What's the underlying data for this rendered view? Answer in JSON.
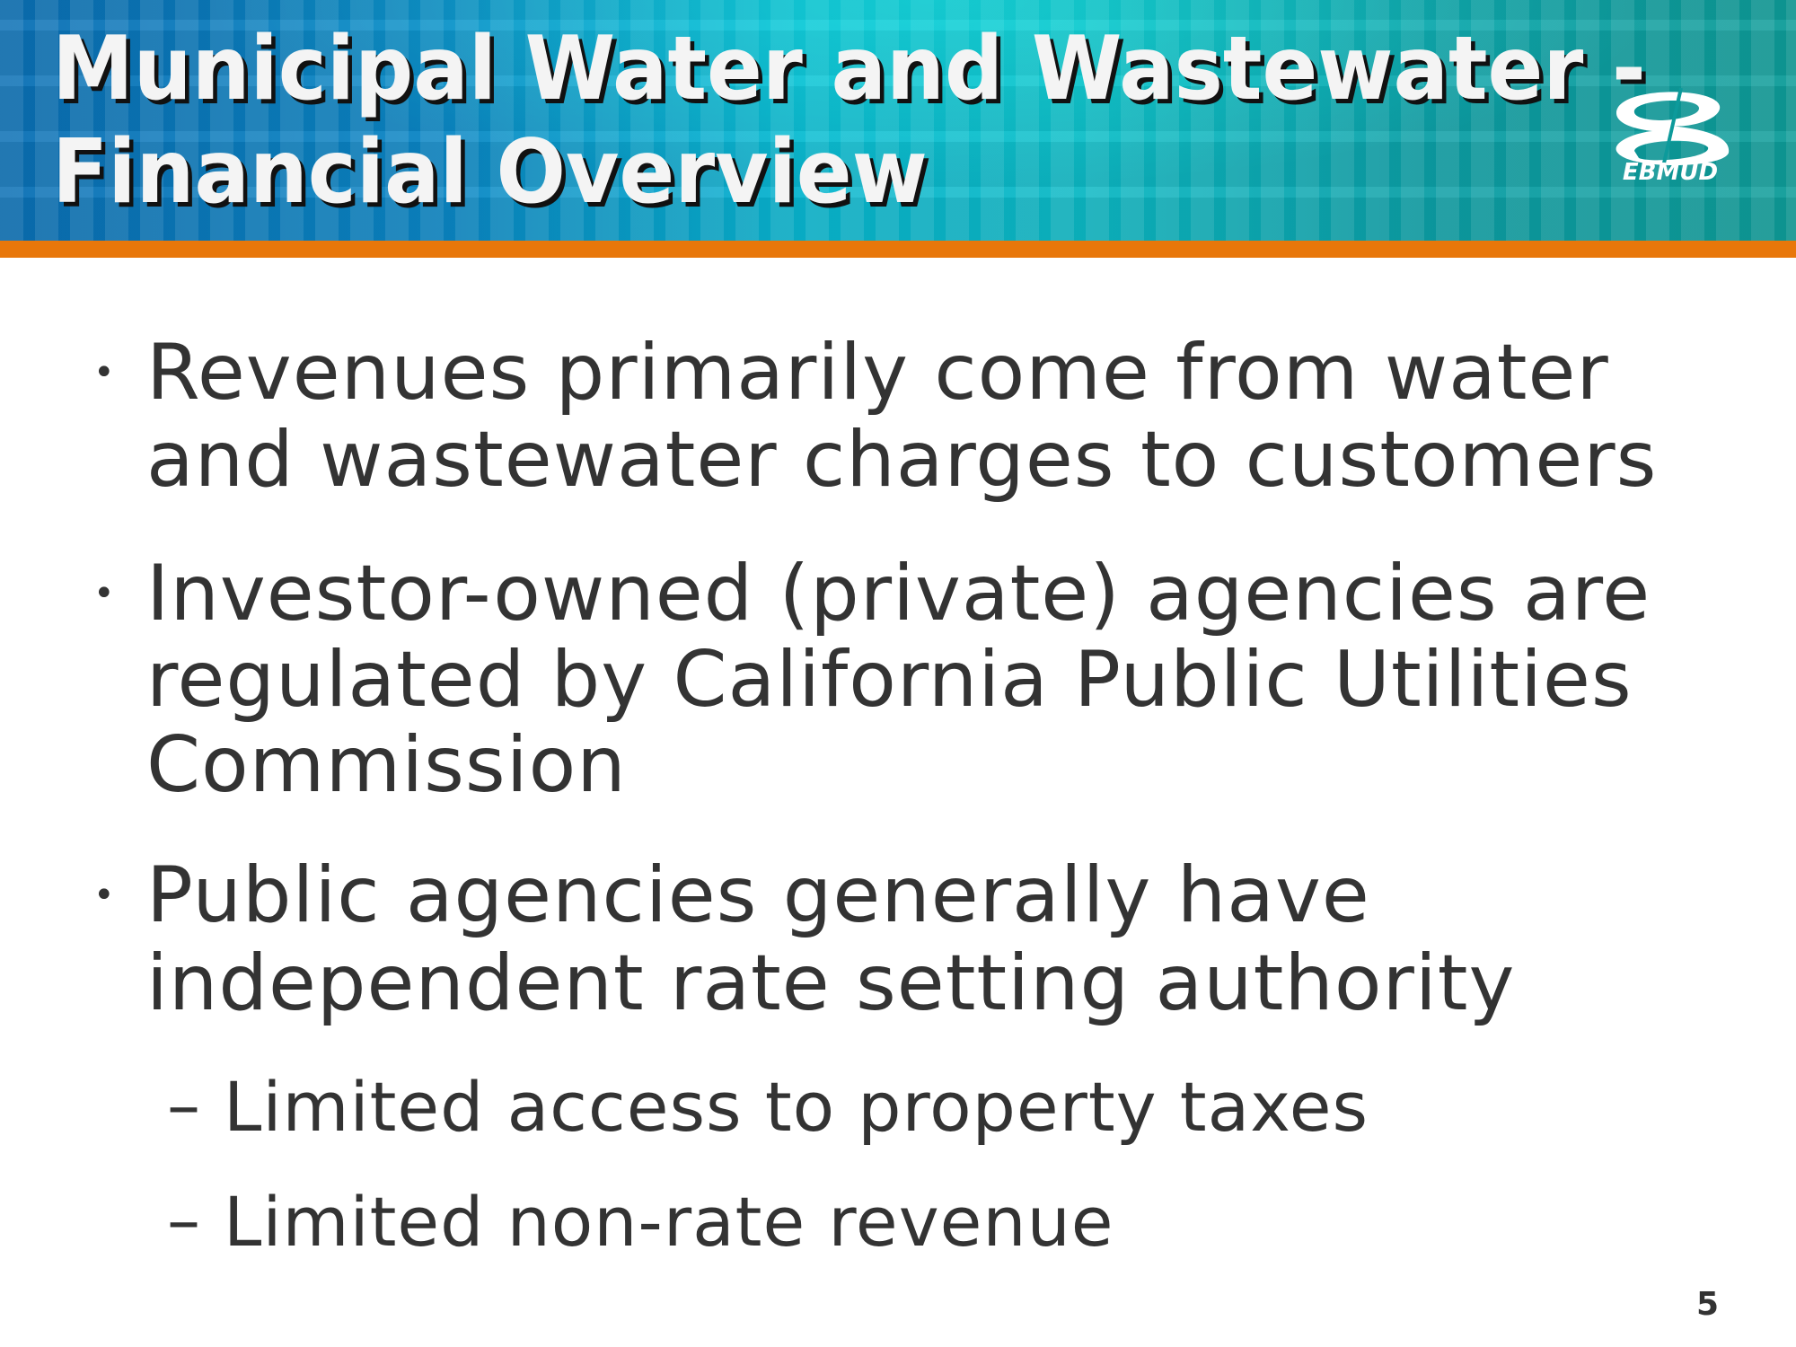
{
  "header": {
    "title_lines": [
      "Municipal Water and Wastewater -",
      "Financial Overview"
    ],
    "logo_text": "EBMUD",
    "colors": {
      "banner": "#0a86c4",
      "accent_bar": "#e8770a"
    }
  },
  "bullets": [
    {
      "lines": [
        "Revenues primarily come from water",
        "and wastewater charges to customers"
      ]
    },
    {
      "lines": [
        "Investor-owned (private) agencies are",
        "regulated by California Public Utilities",
        "Commission"
      ]
    },
    {
      "lines": [
        "Public agencies generally have",
        "independent rate setting authority"
      ],
      "sub_items": [
        "Limited access to property taxes",
        "Limited non-rate revenue"
      ]
    }
  ],
  "bullet_glyph": "•",
  "sub_glyph": "–",
  "page_number": "5"
}
